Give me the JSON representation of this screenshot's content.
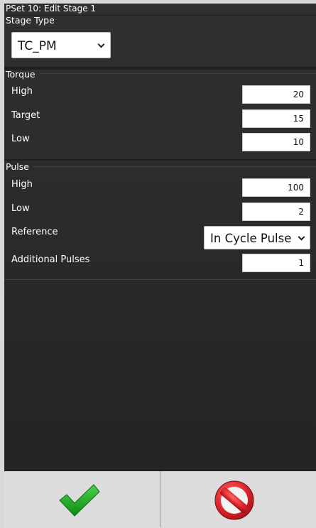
{
  "window": {
    "title": "PSet 10: Edit Stage 1"
  },
  "stage_type": {
    "label": "Stage Type",
    "selected": "TC_PM"
  },
  "torque": {
    "label": "Torque",
    "high": {
      "label": "High",
      "value": "20"
    },
    "target": {
      "label": "Target",
      "value": "15"
    },
    "low": {
      "label": "Low",
      "value": "10"
    }
  },
  "pulse": {
    "label": "Pulse",
    "high": {
      "label": "High",
      "value": "100"
    },
    "low": {
      "label": "Low",
      "value": "2"
    },
    "reference": {
      "label": "Reference",
      "selected": "In Cycle Pulse"
    },
    "additional": {
      "label": "Additional Pulses",
      "value": "1"
    }
  },
  "footer": {
    "confirm_icon": "check-icon",
    "cancel_icon": "no-entry-icon",
    "colors": {
      "confirm": "#1aa51a",
      "cancel": "#d9232a"
    }
  }
}
